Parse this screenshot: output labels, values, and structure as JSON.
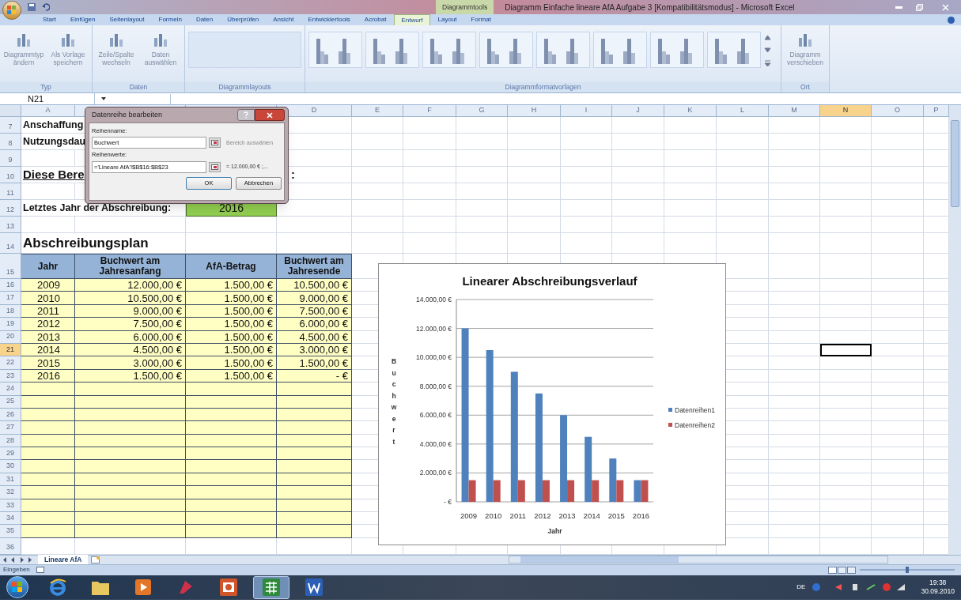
{
  "window": {
    "title": "Diagramm Einfache lineare AfA Aufgabe 3  [Kompatibilitätsmodus] - Microsoft Excel",
    "context_group": "Diagrammtools"
  },
  "ribbon": {
    "tabs": [
      {
        "label": "Start",
        "selected": false
      },
      {
        "label": "Einfügen",
        "selected": false
      },
      {
        "label": "Seitenlayout",
        "selected": false
      },
      {
        "label": "Formeln",
        "selected": false
      },
      {
        "label": "Daten",
        "selected": false
      },
      {
        "label": "Überprüfen",
        "selected": false
      },
      {
        "label": "Ansicht",
        "selected": false
      },
      {
        "label": "Entwicklertools",
        "selected": false
      },
      {
        "label": "Acrobat",
        "selected": false
      },
      {
        "label": "Entwurf",
        "selected": true
      },
      {
        "label": "Layout",
        "selected": false
      },
      {
        "label": "Format",
        "selected": false
      }
    ],
    "groups": [
      {
        "label": "Typ",
        "kind": "buttons",
        "buttons": [
          "Diagrammtyp ändern",
          "Als Vorlage speichern"
        ]
      },
      {
        "label": "Daten",
        "kind": "buttons",
        "buttons": [
          "Zeile/Spalte wechseln",
          "Daten auswählen"
        ]
      },
      {
        "label": "Diagrammlayouts",
        "kind": "empty_gallery"
      },
      {
        "label": "Diagrammformatvorlagen",
        "kind": "style_gallery"
      },
      {
        "label": "Ort",
        "kind": "buttons",
        "buttons": [
          "Diagramm verschieben"
        ]
      }
    ]
  },
  "formula_bar": {
    "name_box": "N21"
  },
  "sheet": {
    "columns": [
      {
        "label": "A",
        "selected": false
      },
      {
        "selected": false
      },
      {
        "selected": false
      },
      {
        "label": "D",
        "selected": false
      },
      {
        "label": "E",
        "selected": false
      },
      {
        "label": "F",
        "selected": false
      },
      {
        "label": "G",
        "selected": false
      },
      {
        "label": "H",
        "selected": false
      },
      {
        "label": "I",
        "selected": false
      },
      {
        "label": "J",
        "selected": false
      },
      {
        "label": "K",
        "selected": false
      },
      {
        "label": "L",
        "selected": false
      },
      {
        "label": "M",
        "selected": false
      },
      {
        "label": "N",
        "selected": true
      },
      {
        "label": "O",
        "selected": false
      },
      {
        "label": "P",
        "selected": false
      }
    ],
    "rows": [
      {
        "number": "7",
        "selected": false,
        "kind": "label",
        "text": "Anschaffung"
      },
      {
        "number": "8",
        "selected": false,
        "kind": "label",
        "text": "Nutzungsdau"
      },
      {
        "number": "9",
        "selected": false,
        "kind": "blank"
      },
      {
        "number": "10",
        "selected": false,
        "kind": "heading",
        "text": "Diese Bere",
        "text_2": ":"
      },
      {
        "number": "11",
        "selected": false,
        "kind": "blank"
      },
      {
        "number": "12",
        "selected": false,
        "kind": "input",
        "text": "Letztes Jahr der Abschreibung:",
        "value": "2016"
      },
      {
        "number": "13",
        "selected": false,
        "kind": "blank"
      },
      {
        "number": "14",
        "selected": false,
        "kind": "title",
        "text": "Abschreibungsplan"
      },
      {
        "number": "15",
        "selected": false,
        "kind": "table_head",
        "cells": [
          "Jahr",
          "Buchwert am Jahresanfang",
          "AfA-Betrag",
          "Buchwert am Jahresende"
        ]
      },
      {
        "number": "16",
        "selected": false,
        "kind": "table_row",
        "cells": [
          "2009",
          "12.000,00 €",
          "1.500,00 €",
          "10.500,00 €"
        ]
      },
      {
        "number": "17",
        "selected": false,
        "kind": "table_row",
        "cells": [
          "2010",
          "10.500,00 €",
          "1.500,00 €",
          "9.000,00 €"
        ]
      },
      {
        "number": "18",
        "selected": false,
        "kind": "table_row",
        "cells": [
          "2011",
          "9.000,00 €",
          "1.500,00 €",
          "7.500,00 €"
        ]
      },
      {
        "number": "19",
        "selected": false,
        "kind": "table_row",
        "cells": [
          "2012",
          "7.500,00 €",
          "1.500,00 €",
          "6.000,00 €"
        ]
      },
      {
        "number": "20",
        "selected": false,
        "kind": "table_row",
        "cells": [
          "2013",
          "6.000,00 €",
          "1.500,00 €",
          "4.500,00 €"
        ]
      },
      {
        "number": "21",
        "selected": true,
        "kind": "table_row",
        "cells": [
          "2014",
          "4.500,00 €",
          "1.500,00 €",
          "3.000,00 €"
        ]
      },
      {
        "number": "22",
        "selected": false,
        "kind": "table_row",
        "cells": [
          "2015",
          "3.000,00 €",
          "1.500,00 €",
          "1.500,00 €"
        ]
      },
      {
        "number": "23",
        "selected": false,
        "kind": "table_row",
        "cells": [
          "2016",
          "1.500,00 €",
          "1.500,00 €",
          "- €"
        ]
      },
      {
        "number": "24",
        "selected": false,
        "kind": "table_empty"
      },
      {
        "number": "25",
        "selected": false,
        "kind": "table_empty"
      },
      {
        "number": "26",
        "selected": false,
        "kind": "table_empty"
      },
      {
        "number": "27",
        "selected": false,
        "kind": "table_empty"
      },
      {
        "number": "28",
        "selected": false,
        "kind": "table_empty"
      },
      {
        "number": "29",
        "selected": false,
        "kind": "table_empty"
      },
      {
        "number": "30",
        "selected": false,
        "kind": "table_empty"
      },
      {
        "number": "31",
        "selected": false,
        "kind": "table_empty"
      },
      {
        "number": "32",
        "selected": false,
        "kind": "table_empty"
      },
      {
        "number": "33",
        "selected": false,
        "kind": "table_empty"
      },
      {
        "number": "34",
        "selected": false,
        "kind": "table_empty"
      },
      {
        "number": "35",
        "selected": false,
        "kind": "table_empty"
      },
      {
        "number": "36",
        "selected": false,
        "kind": "blank"
      }
    ],
    "tabs": [
      {
        "label": "Lineare AfA",
        "selected": true
      }
    ]
  },
  "chart": {
    "chart_data": {
      "type": "bar",
      "title": "Linearer Abschreibungsverlauf",
      "xlabel": "Jahr",
      "ylabel": "Buchwert",
      "categories": [
        "2009",
        "2010",
        "2011",
        "2012",
        "2013",
        "2014",
        "2015",
        "2016"
      ],
      "series": [
        {
          "name": "Datenreihen1",
          "color": "#4f81bd",
          "values": [
            12000,
            10500,
            9000,
            7500,
            6000,
            4500,
            3000,
            1500
          ]
        },
        {
          "name": "Datenreihen2",
          "color": "#c0504d",
          "values": [
            1500,
            1500,
            1500,
            1500,
            1500,
            1500,
            1500,
            1500
          ]
        }
      ],
      "ylim": [
        0,
        14000
      ],
      "grid": true,
      "legend": "right",
      "yticks": [
        {
          "value": 0,
          "label": "- €"
        },
        {
          "value": 2000,
          "label": "2.000,00 €"
        },
        {
          "value": 4000,
          "label": "4.000,00 €"
        },
        {
          "value": 6000,
          "label": "6.000,00 €"
        },
        {
          "value": 8000,
          "label": "8.000,00 €"
        },
        {
          "value": 10000,
          "label": "10.000,00 €"
        },
        {
          "value": 12000,
          "label": "12.000,00 €"
        },
        {
          "value": 14000,
          "label": "14.000,00 €"
        }
      ]
    }
  },
  "dialog": {
    "title": "Datenreihe bearbeiten",
    "name_label": "Reihenname:",
    "name_value": "Buchwert",
    "name_hint": "Bereich auswählen",
    "values_label": "Reihenwerte:",
    "values_value": "='Lineare AfA'!$B$16:$B$23",
    "values_hint": "= 12.000,00 € ;...",
    "buttons": [
      "OK",
      "Abbrechen"
    ]
  },
  "status_bar": {
    "mode": "Eingeben",
    "zoom": {
      "level": 0.5
    }
  },
  "taskbar": {
    "apps": [
      {
        "kind": "browser",
        "active": false
      },
      {
        "kind": "folder",
        "active": false
      },
      {
        "kind": "media",
        "active": false
      },
      {
        "kind": "pdf",
        "active": false
      },
      {
        "kind": "slides",
        "active": false
      },
      {
        "kind": "spreadsheet",
        "active": true
      },
      {
        "kind": "document",
        "active": false
      }
    ],
    "language": "DE",
    "time": "19:38",
    "date": "30.09.2010"
  }
}
